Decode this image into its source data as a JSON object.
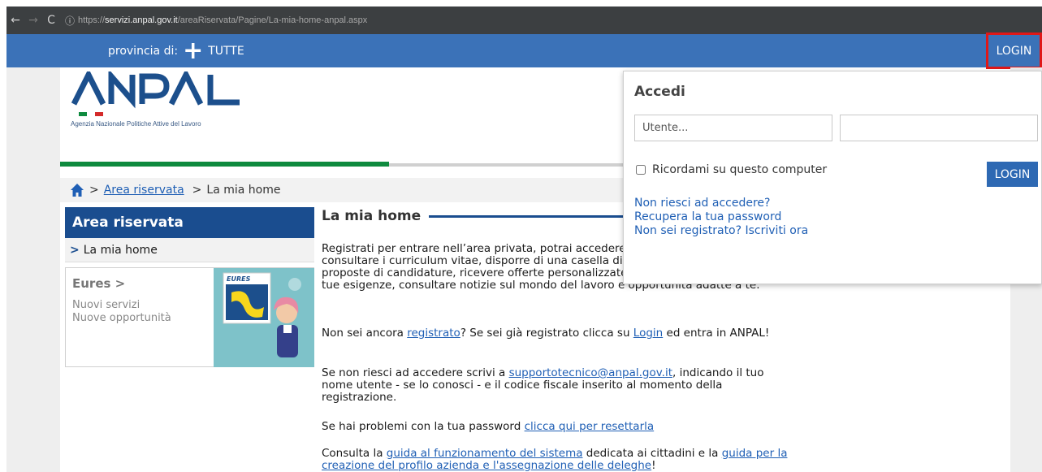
{
  "browser": {
    "url_scheme": "https://",
    "url_host": "servizi.anpal.gov.it",
    "url_path": "/areaRiservata/Pagine/La-mia-home-anpal.aspx"
  },
  "topbar": {
    "provincia_label": "provincia di:",
    "provincia_value": "TUTTE",
    "login_label": "LOGIN"
  },
  "logo": {
    "text": "ANPAL",
    "subtitle": "Agenzia Nazionale Politiche Attive del Lavoro"
  },
  "breadcrumb": {
    "sep": ">",
    "area": "Area riservata",
    "current": "La mia home"
  },
  "sidebar": {
    "title": "Area riservata",
    "item": "La mia home",
    "eures": {
      "title": "Eures >",
      "link1": "Nuovi servizi",
      "link2": "Nuove opportunità",
      "image_text": "EURES"
    }
  },
  "main": {
    "title": "La mia home",
    "p1": "Registrati per entrare nell’area privata, potrai accedere ai servizi, inserire e consultare i curriculum vitae, disporre di una casella di messaggi, inviare e ricevere proposte di candidature, ricevere offerte personalizzate in linea con il tuo profilo e le tue esigenze, consultare notizie sul mondo del lavoro e opportunità adatte a te.",
    "p2_a": "Non sei ancora ",
    "p2_link1": "registrato",
    "p2_b": "? Se sei già registrato clicca su ",
    "p2_link2": "Login",
    "p2_c": " ed entra in ANPAL!",
    "p3_a": "Se non riesci ad accedere scrivi a ",
    "p3_link": "supportotecnico@anpal.gov.it",
    "p3_b": ", indicando il tuo nome utente - se lo conosci - e il codice fiscale inserito al momento della registrazione.",
    "p4_a": "Se hai problemi con la tua password ",
    "p4_link": "clicca qui per resettarla",
    "p5_a": "Consulta la ",
    "p5_link1": "guida al funzionamento del sistema",
    "p5_b": " dedicata ai cittadini e la ",
    "p5_link2": "guida per la creazione del profilo azienda e l'assegnazione delle deleghe",
    "p5_c": "!"
  },
  "login_panel": {
    "title": "Accedi",
    "user_placeholder": "Utente...",
    "password_placeholder": "",
    "remember_label": "Ricordami su questo computer",
    "button": "LOGIN",
    "link1": "Non riesci ad accedere?",
    "link2": "Recupera la tua password",
    "link3": "Non sei registrato? Iscriviti ora"
  },
  "colors": {
    "navbar": "#3b72b8",
    "sidebar_title": "#1a4d8f",
    "green_bar": "#0e8a3e",
    "highlight": "#e01818"
  }
}
